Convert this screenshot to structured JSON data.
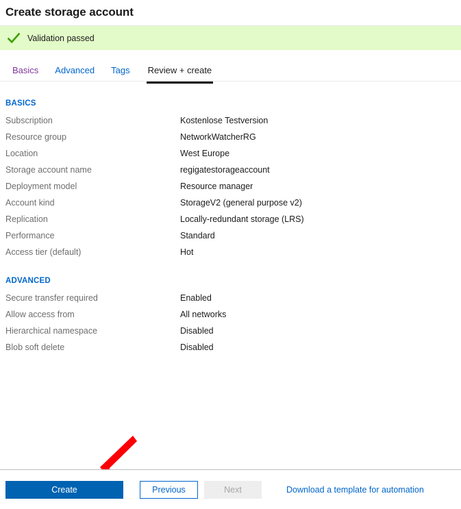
{
  "header": {
    "title": "Create storage account"
  },
  "validation": {
    "icon": "check-icon",
    "message": "Validation passed",
    "banner_color": "#e3fbc8",
    "check_color": "#3da000"
  },
  "tabs": [
    {
      "label": "Basics",
      "state": "visited"
    },
    {
      "label": "Advanced",
      "state": "link"
    },
    {
      "label": "Tags",
      "state": "link"
    },
    {
      "label": "Review + create",
      "state": "active"
    }
  ],
  "sections": [
    {
      "title": "BASICS",
      "rows": [
        {
          "label": "Subscription",
          "value": "Kostenlose Testversion"
        },
        {
          "label": "Resource group",
          "value": "NetworkWatcherRG"
        },
        {
          "label": "Location",
          "value": "West Europe"
        },
        {
          "label": "Storage account name",
          "value": "regigatestorageaccount"
        },
        {
          "label": "Deployment model",
          "value": "Resource manager"
        },
        {
          "label": "Account kind",
          "value": "StorageV2 (general purpose v2)"
        },
        {
          "label": "Replication",
          "value": "Locally-redundant storage (LRS)"
        },
        {
          "label": "Performance",
          "value": "Standard"
        },
        {
          "label": "Access tier (default)",
          "value": "Hot"
        }
      ]
    },
    {
      "title": "ADVANCED",
      "rows": [
        {
          "label": "Secure transfer required",
          "value": "Enabled"
        },
        {
          "label": "Allow access from",
          "value": "All networks"
        },
        {
          "label": "Hierarchical namespace",
          "value": "Disabled"
        },
        {
          "label": "Blob soft delete",
          "value": "Disabled"
        }
      ]
    }
  ],
  "footer": {
    "create_label": "Create",
    "previous_label": "Previous",
    "next_label": "Next",
    "download_link_label": "Download a template for automation"
  },
  "annotation": {
    "type": "arrow",
    "color": "#fb0007",
    "points_to": "create-button"
  },
  "colors": {
    "accent_blue": "#0066cc",
    "primary_button": "#0063b1",
    "visited_link": "#7f359b",
    "label_gray": "#6e6e6e"
  }
}
